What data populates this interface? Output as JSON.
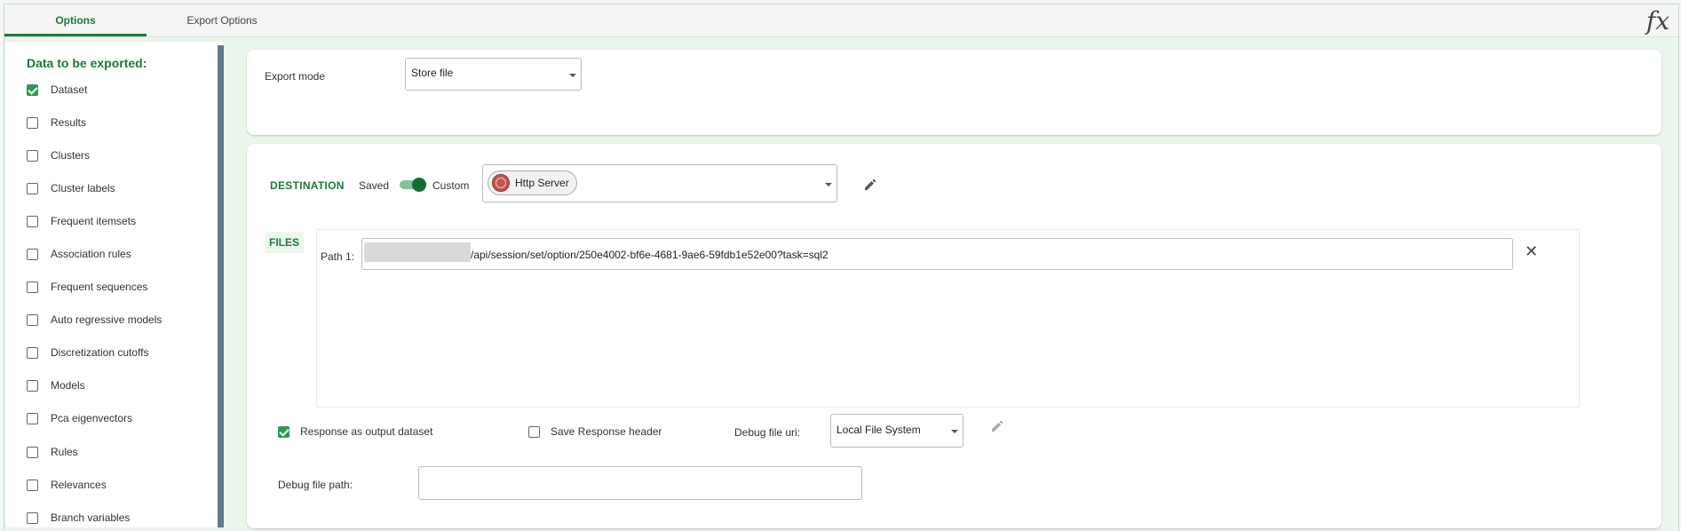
{
  "tabs": [
    {
      "label": "Options",
      "active": true
    },
    {
      "label": "Export Options",
      "active": false
    }
  ],
  "toolbar": {
    "fx_label": "fx"
  },
  "sidebar": {
    "title": "Data to be exported:",
    "items": [
      {
        "label": "Dataset",
        "checked": true
      },
      {
        "label": "Results",
        "checked": false
      },
      {
        "label": "Clusters",
        "checked": false
      },
      {
        "label": "Cluster labels",
        "checked": false
      },
      {
        "label": "Frequent itemsets",
        "checked": false
      },
      {
        "label": "Association rules",
        "checked": false
      },
      {
        "label": "Frequent sequences",
        "checked": false
      },
      {
        "label": "Auto regressive models",
        "checked": false
      },
      {
        "label": "Discretization cutoffs",
        "checked": false
      },
      {
        "label": "Models",
        "checked": false
      },
      {
        "label": "Pca eigenvectors",
        "checked": false
      },
      {
        "label": "Rules",
        "checked": false
      },
      {
        "label": "Relevances",
        "checked": false
      },
      {
        "label": "Branch variables",
        "checked": false
      }
    ]
  },
  "export_mode": {
    "label": "Export mode",
    "value": "Store file"
  },
  "destination": {
    "title": "DESTINATION",
    "saved_label": "Saved",
    "custom_label": "Custom",
    "toggle_on": true,
    "server": "Http Server",
    "server_icon": "globe-icon"
  },
  "files": {
    "tag": "FILES",
    "path_label": "Path 1:",
    "path_value": "/api/session/set/option/250e4002-bf6e-4681-9ae6-59fdb1e52e00?task=sql2"
  },
  "options": {
    "response_as_output": {
      "label": "Response as output dataset",
      "checked": true
    },
    "save_response_header": {
      "label": "Save Response header",
      "checked": false
    },
    "debug_uri_label": "Debug file uri:",
    "debug_uri_value": "Local File System",
    "debug_path_label": "Debug file path:",
    "debug_path_value": ""
  },
  "colors": {
    "accent": "#1b7a3c",
    "checkbox": "#2e9a54",
    "background": "#eaf5ec"
  }
}
